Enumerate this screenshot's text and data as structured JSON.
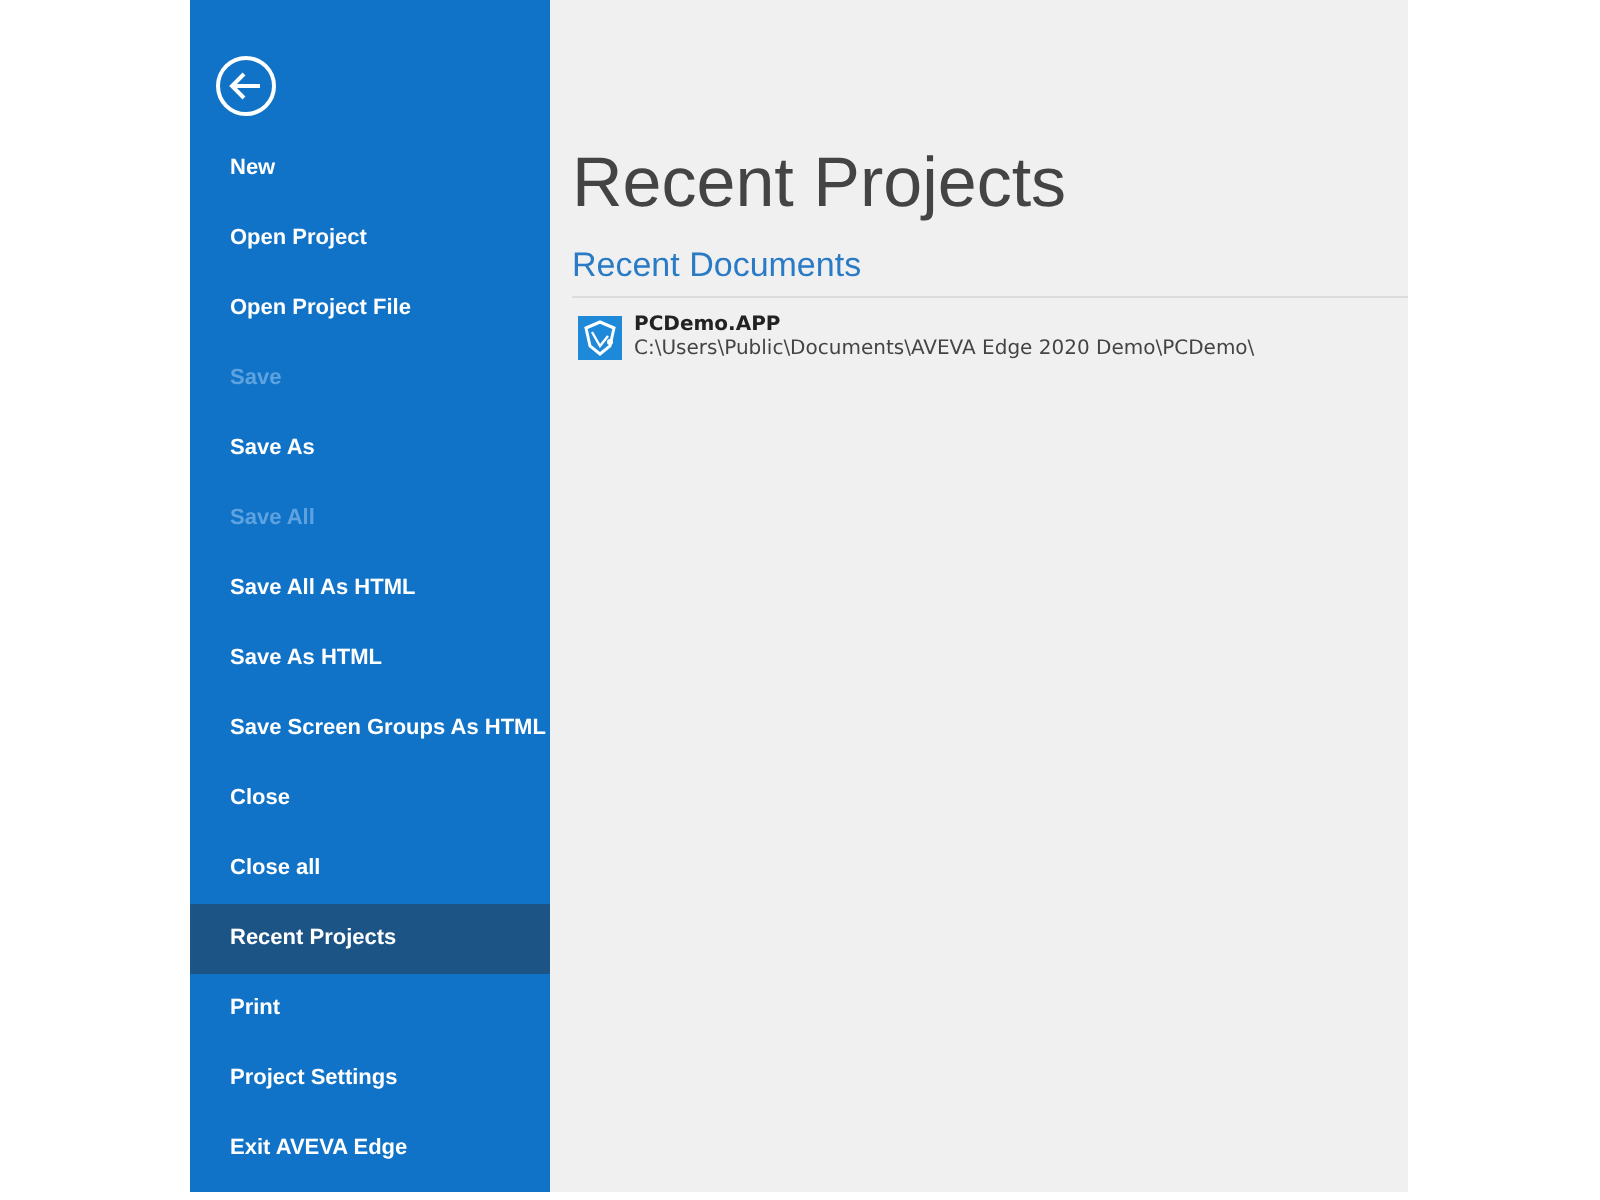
{
  "sidebar": {
    "items": [
      {
        "label": "New",
        "disabled": false,
        "selected": false
      },
      {
        "label": "Open Project",
        "disabled": false,
        "selected": false
      },
      {
        "label": "Open Project File",
        "disabled": false,
        "selected": false
      },
      {
        "label": "Save",
        "disabled": true,
        "selected": false
      },
      {
        "label": "Save As",
        "disabled": false,
        "selected": false
      },
      {
        "label": "Save All",
        "disabled": true,
        "selected": false
      },
      {
        "label": "Save All As HTML",
        "disabled": false,
        "selected": false
      },
      {
        "label": "Save As HTML",
        "disabled": false,
        "selected": false
      },
      {
        "label": "Save Screen Groups As HTML",
        "disabled": false,
        "selected": false
      },
      {
        "label": "Close",
        "disabled": false,
        "selected": false
      },
      {
        "label": "Close all",
        "disabled": false,
        "selected": false
      },
      {
        "label": "Recent Projects",
        "disabled": false,
        "selected": true
      },
      {
        "label": "Print",
        "disabled": false,
        "selected": false
      },
      {
        "label": "Project Settings",
        "disabled": false,
        "selected": false
      },
      {
        "label": "Exit AVEVA Edge",
        "disabled": false,
        "selected": false
      }
    ]
  },
  "main": {
    "title": "Recent Projects",
    "section": "Recent Documents",
    "documents": [
      {
        "name": "PCDemo.APP",
        "path": "C:\\Users\\Public\\Documents\\AVEVA Edge 2020 Demo\\PCDemo\\"
      }
    ]
  }
}
